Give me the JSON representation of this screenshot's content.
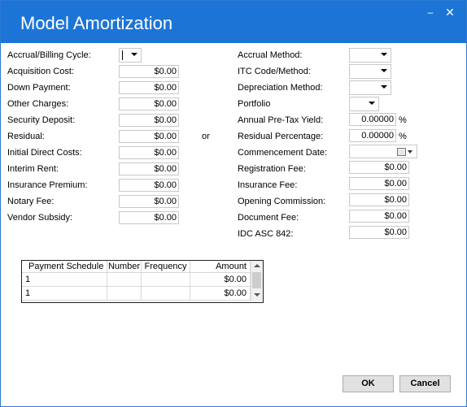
{
  "window": {
    "title": "Model Amortization",
    "minimize_icon": "minimize-icon",
    "close_icon": "close-icon"
  },
  "left_fields": [
    {
      "label": "Accrual/Billing Cycle:",
      "type": "dropdown",
      "value": ""
    },
    {
      "label": "Acquisition Cost:",
      "value": "$0.00"
    },
    {
      "label": "Down Payment:",
      "value": "$0.00"
    },
    {
      "label": "Other Charges:",
      "value": "$0.00"
    },
    {
      "label": "Security Deposit:",
      "value": "$0.00"
    },
    {
      "label": "Residual:",
      "value": "$0.00"
    },
    {
      "label": "Initial Direct Costs:",
      "value": "$0.00"
    },
    {
      "label": "Interim Rent:",
      "value": "$0.00"
    },
    {
      "label": "Insurance Premium:",
      "value": "$0.00"
    },
    {
      "label": "Notary Fee:",
      "value": "$0.00"
    },
    {
      "label": "Vendor Subsidy:",
      "value": "$0.00"
    }
  ],
  "or_label": "or",
  "right_fields": {
    "accrual_method": {
      "label": "Accrual Method:",
      "value": ""
    },
    "itc_code": {
      "label": "ITC Code/Method:",
      "value": ""
    },
    "depreciation_method": {
      "label": "Depreciation Method:",
      "value": ""
    },
    "portfolio": {
      "label": "Portfolio",
      "value": ""
    },
    "annual_yield": {
      "label": "Annual Pre-Tax Yield:",
      "value": "0.00000",
      "unit": "%"
    },
    "residual_pct": {
      "label": "Residual Percentage:",
      "value": "0.00000",
      "unit": "%"
    },
    "commencement_date": {
      "label": "Commencement Date:",
      "value": ""
    },
    "registration_fee": {
      "label": "Registration Fee:",
      "value": "$0.00"
    },
    "insurance_fee": {
      "label": "Insurance Fee:",
      "value": "$0.00"
    },
    "opening_commission": {
      "label": "Opening Commission:",
      "value": "$0.00"
    },
    "document_fee": {
      "label": "Document Fee:",
      "value": "$0.00"
    },
    "idc_asc": {
      "label": "IDC ASC 842:",
      "value": "$0.00"
    }
  },
  "schedule": {
    "columns": [
      "Payment Schedule",
      "Number",
      "Frequency",
      "Amount"
    ],
    "rows": [
      [
        "1",
        "",
        "",
        "$0.00"
      ],
      [
        "1",
        "",
        "",
        "$0.00"
      ]
    ]
  },
  "buttons": {
    "ok": "OK",
    "cancel": "Cancel"
  }
}
